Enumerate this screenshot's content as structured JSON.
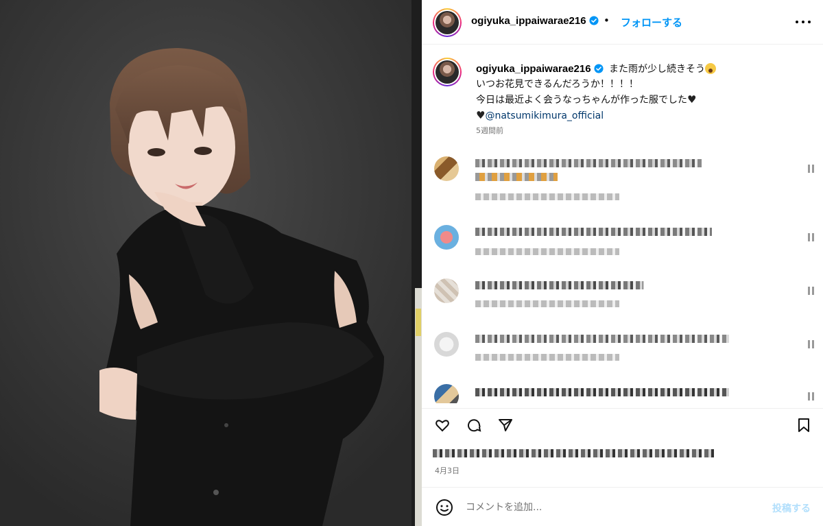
{
  "post": {
    "username": "ogiyuka_ippaiwarae216",
    "follow_separator": "•",
    "follow_label": "フォローする",
    "more_icon": "more-horizontal-icon",
    "verified_icon": "verified-badge-icon"
  },
  "caption": {
    "line1": "また雨が少し続きそう",
    "line2": "いつお花見できるんだろうか！！！！",
    "line3": "今日は最近よく会うなっちゃんが作った服でした",
    "mention": "@natsumikimura_official",
    "time_ago": "5週間前"
  },
  "actions": {
    "icons": [
      "heart-icon",
      "comment-icon",
      "share-icon",
      "save-icon"
    ],
    "date": "4月3日"
  },
  "comment_input": {
    "placeholder": "コメントを追加...",
    "post_label": "投稿する"
  },
  "colors": {
    "link_blue": "#0095f6",
    "mention_blue": "#00376b",
    "post_disabled": "#b2dffc",
    "meta_gray": "#737373"
  }
}
